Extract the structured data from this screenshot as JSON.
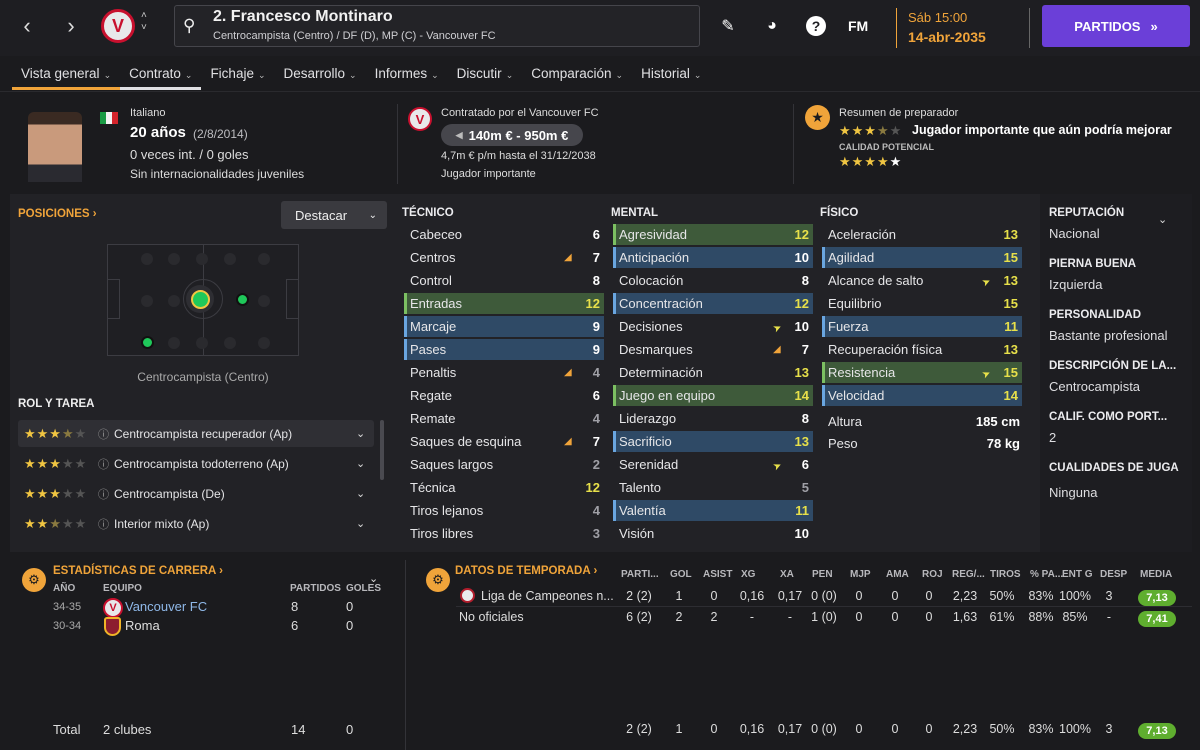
{
  "header": {
    "player_name": "2. Francesco Montinaro",
    "player_sub": "Centrocampista (Centro) / DF (D), MP (C) - Vancouver FC",
    "date_line1": "Sáb 15:00",
    "date_line2": "14-abr-2035",
    "fm_label": "FM",
    "help_label": "?",
    "partidos_label": "PARTIDOS",
    "crest_letter": "V"
  },
  "tabs": [
    {
      "label": "Vista general"
    },
    {
      "label": "Contrato"
    },
    {
      "label": "Fichaje"
    },
    {
      "label": "Desarrollo"
    },
    {
      "label": "Informes"
    },
    {
      "label": "Discutir"
    },
    {
      "label": "Comparación"
    },
    {
      "label": "Historial"
    }
  ],
  "profile": {
    "nationality": "Italiano",
    "age": "20 años",
    "dob": "(2/8/2014)",
    "caps": "0 veces int. / 0 goles",
    "youth": "Sin internacionalidades juveniles",
    "flag_colors": [
      "#1a9c45",
      "#f4f4f4",
      "#d5242c"
    ]
  },
  "contract": {
    "signed_by": "Contratado por el Vancouver FC",
    "value": "140m € - 950m €",
    "wage": "4,7m € p/m hasta el 31/12/2038",
    "status": "Jugador importante"
  },
  "coach": {
    "title": "Resumen de preparador",
    "current_stars": 3.5,
    "summary": "Jugador importante que aún podría mejorar",
    "potential_label": "CALIDAD POTENCIAL",
    "potential_stars": 4
  },
  "positions": {
    "title": "POSICIONES",
    "highlight_label": "Destacar",
    "pitch_caption": "Centrocampista (Centro)"
  },
  "roles": {
    "title": "ROL Y TAREA",
    "items": [
      {
        "stars": "★★★",
        "half": "★",
        "off": "★",
        "name": "Centrocampista recuperador (Ap)"
      },
      {
        "stars": "★★★",
        "half": "",
        "off": "★★",
        "name": "Centrocampista todoterreno (Ap)"
      },
      {
        "stars": "★★★",
        "half": "",
        "off": "★★",
        "name": "Centrocampista (De)"
      },
      {
        "stars": "★★",
        "half": "★",
        "off": "★★",
        "name": "Interior mixto (Ap)"
      }
    ]
  },
  "attributes": {
    "tecnico_title": "TÉCNICO",
    "mental_title": "MENTAL",
    "fisico_title": "FÍSICO",
    "tecnico": [
      {
        "n": "Cabeceo",
        "v": "6",
        "h": "",
        "c": "",
        "a": ""
      },
      {
        "n": "Centros",
        "v": "7",
        "h": "",
        "c": "",
        "a": "up"
      },
      {
        "n": "Control",
        "v": "8",
        "h": "",
        "c": "",
        "a": ""
      },
      {
        "n": "Entradas",
        "v": "12",
        "h": "g",
        "c": "y",
        "a": ""
      },
      {
        "n": "Marcaje",
        "v": "9",
        "h": "b",
        "c": "",
        "a": ""
      },
      {
        "n": "Pases",
        "v": "9",
        "h": "b",
        "c": "",
        "a": ""
      },
      {
        "n": "Penaltis",
        "v": "4",
        "h": "",
        "c": "m",
        "a": "up"
      },
      {
        "n": "Regate",
        "v": "6",
        "h": "",
        "c": "",
        "a": ""
      },
      {
        "n": "Remate",
        "v": "4",
        "h": "",
        "c": "m",
        "a": ""
      },
      {
        "n": "Saques de esquina",
        "v": "7",
        "h": "",
        "c": "",
        "a": "up"
      },
      {
        "n": "Saques largos",
        "v": "2",
        "h": "",
        "c": "m",
        "a": ""
      },
      {
        "n": "Técnica",
        "v": "12",
        "h": "",
        "c": "y",
        "a": ""
      },
      {
        "n": "Tiros lejanos",
        "v": "4",
        "h": "",
        "c": "m",
        "a": ""
      },
      {
        "n": "Tiros libres",
        "v": "3",
        "h": "",
        "c": "m",
        "a": ""
      }
    ],
    "mental": [
      {
        "n": "Agresividad",
        "v": "12",
        "h": "g",
        "c": "y",
        "a": ""
      },
      {
        "n": "Anticipación",
        "v": "10",
        "h": "b",
        "c": "",
        "a": ""
      },
      {
        "n": "Colocación",
        "v": "8",
        "h": "",
        "c": "",
        "a": ""
      },
      {
        "n": "Concentración",
        "v": "12",
        "h": "b",
        "c": "y",
        "a": ""
      },
      {
        "n": "Decisiones",
        "v": "10",
        "h": "",
        "c": "",
        "a": "down"
      },
      {
        "n": "Desmarques",
        "v": "7",
        "h": "",
        "c": "",
        "a": "up"
      },
      {
        "n": "Determinación",
        "v": "13",
        "h": "",
        "c": "y",
        "a": ""
      },
      {
        "n": "Juego en equipo",
        "v": "14",
        "h": "g",
        "c": "y",
        "a": ""
      },
      {
        "n": "Liderazgo",
        "v": "8",
        "h": "",
        "c": "",
        "a": ""
      },
      {
        "n": "Sacrificio",
        "v": "13",
        "h": "b",
        "c": "y",
        "a": ""
      },
      {
        "n": "Serenidad",
        "v": "6",
        "h": "",
        "c": "",
        "a": "down"
      },
      {
        "n": "Talento",
        "v": "5",
        "h": "",
        "c": "m",
        "a": ""
      },
      {
        "n": "Valentía",
        "v": "11",
        "h": "b",
        "c": "y",
        "a": ""
      },
      {
        "n": "Visión",
        "v": "10",
        "h": "",
        "c": "",
        "a": ""
      }
    ],
    "fisico": [
      {
        "n": "Aceleración",
        "v": "13",
        "h": "",
        "c": "y",
        "a": ""
      },
      {
        "n": "Agilidad",
        "v": "15",
        "h": "b",
        "c": "y",
        "a": ""
      },
      {
        "n": "Alcance de salto",
        "v": "13",
        "h": "",
        "c": "y",
        "a": "down"
      },
      {
        "n": "Equilibrio",
        "v": "15",
        "h": "",
        "c": "y",
        "a": ""
      },
      {
        "n": "Fuerza",
        "v": "11",
        "h": "b",
        "c": "y",
        "a": ""
      },
      {
        "n": "Recuperación física",
        "v": "13",
        "h": "",
        "c": "y",
        "a": ""
      },
      {
        "n": "Resistencia",
        "v": "15",
        "h": "g",
        "c": "y",
        "a": "down"
      },
      {
        "n": "Velocidad",
        "v": "14",
        "h": "b",
        "c": "y",
        "a": ""
      }
    ],
    "altura_label": "Altura",
    "altura": "185 cm",
    "peso_label": "Peso",
    "peso": "78 kg"
  },
  "side": {
    "reputacion_label": "REPUTACIÓN",
    "reputacion": "Nacional",
    "pierna_label": "PIERNA BUENA",
    "pierna": "Izquierda",
    "personalidad_label": "PERSONALIDAD",
    "personalidad": "Bastante profesional",
    "descripcion_label": "DESCRIPCIÓN DE LA...",
    "descripcion": "Centrocampista",
    "portero_label": "CALIF. COMO PORT...",
    "portero": "2",
    "cualidades_label": "CUALIDADES DE JUGA",
    "cualidades": "Ninguna"
  },
  "career": {
    "title": "ESTADÍSTICAS DE CARRERA",
    "cols": [
      "AÑO",
      "EQUIPO",
      "PARTIDOS",
      "GOLES"
    ],
    "rows": [
      {
        "year": "34-35",
        "team": "Vancouver FC",
        "apps": "8",
        "goals": "0"
      },
      {
        "year": "30-34",
        "team": "Roma",
        "apps": "6",
        "goals": "0"
      }
    ],
    "total_label": "Total",
    "total_clubs": "2 clubes",
    "total_apps": "14",
    "total_goals": "0"
  },
  "season": {
    "title": "DATOS DE TEMPORADA",
    "cols": [
      "PARTI...",
      "GOL",
      "ASIST",
      "XG",
      "XA",
      "PEN",
      "MJP",
      "AMA",
      "ROJ",
      "REG/...",
      "TIROS",
      "% PA...",
      "ENT G",
      "DESP",
      "MEDIA"
    ],
    "rows": [
      {
        "comp": "Liga de Campeones n...",
        "vals": [
          "2 (2)",
          "1",
          "0",
          "0,16",
          "0,17",
          "0 (0)",
          "0",
          "0",
          "0",
          "2,23",
          "50%",
          "83%",
          "100%",
          "3"
        ],
        "media": "7,13"
      },
      {
        "comp": "No oficiales",
        "vals": [
          "6 (2)",
          "2",
          "2",
          "-",
          "-",
          "1 (0)",
          "0",
          "0",
          "0",
          "1,63",
          "61%",
          "88%",
          "85%",
          "-"
        ],
        "media": "7,41"
      }
    ],
    "total": {
      "vals": [
        "2 (2)",
        "1",
        "0",
        "0,16",
        "0,17",
        "0 (0)",
        "0",
        "0",
        "0",
        "2,23",
        "50%",
        "83%",
        "100%",
        "3"
      ],
      "media": "7,13"
    }
  },
  "colors": {
    "accent": "#f0a43a",
    "purple": "#6b3fd8",
    "green_highlight": "#3e5a3a",
    "blue_highlight": "#2f4a66",
    "good_value": "#e7e04a",
    "media_green": "#5fae2f"
  }
}
